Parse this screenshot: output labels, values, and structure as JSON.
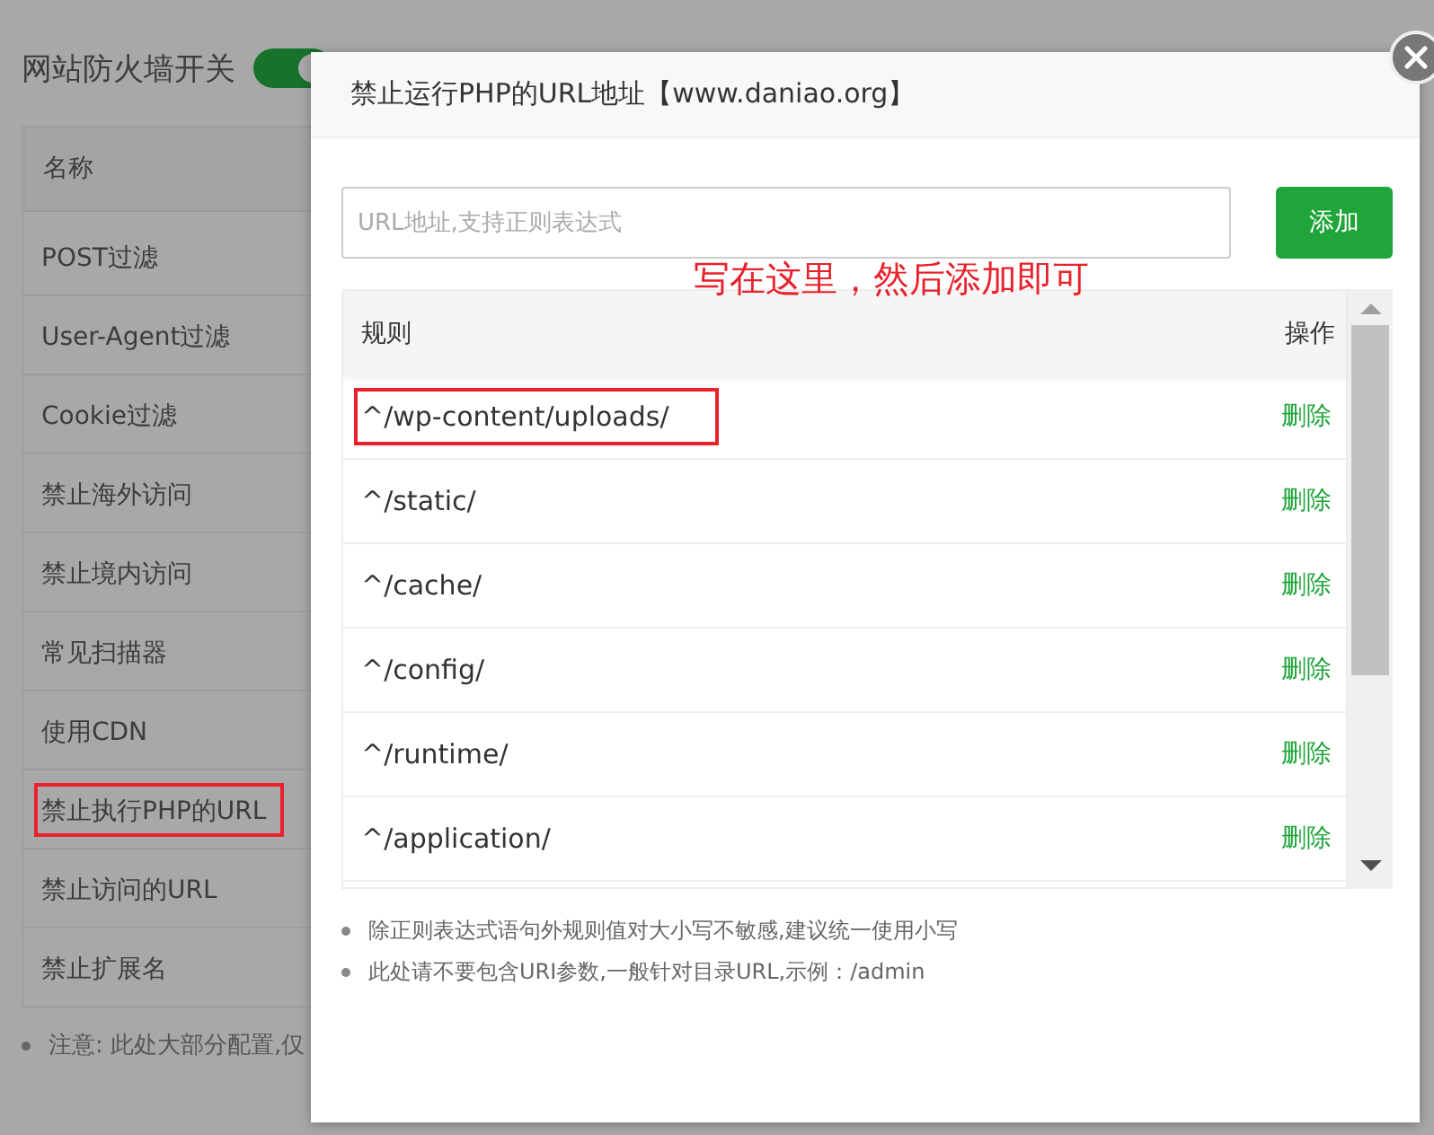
{
  "page": {
    "title": "网站防火墙开关",
    "switch_on": true,
    "column": "名称",
    "items": [
      {
        "label": "POST过滤",
        "annotated": false
      },
      {
        "label": "User-Agent过滤",
        "annotated": false
      },
      {
        "label": "Cookie过滤",
        "annotated": false
      },
      {
        "label": "禁止海外访问",
        "annotated": false
      },
      {
        "label": "禁止境内访问",
        "annotated": false
      },
      {
        "label": "常见扫描器",
        "annotated": false
      },
      {
        "label": "使用CDN",
        "annotated": false
      },
      {
        "label": "禁止执行PHP的URL",
        "annotated": true
      },
      {
        "label": "禁止访问的URL",
        "annotated": false
      },
      {
        "label": "禁止扩展名",
        "annotated": false
      }
    ],
    "note": "注意: 此处大部分配置,仅"
  },
  "dialog": {
    "title": "禁止运行PHP的URL地址【www.daniao.org】",
    "placeholder": "URL地址,支持正则表达式",
    "add_button": "添加",
    "annotation": "写在这里，然后添加即可",
    "columns": [
      "规则",
      "操作"
    ],
    "rows": [
      {
        "rule": "^/wp-content/uploads/",
        "action": "删除",
        "annotated": true
      },
      {
        "rule": "^/static/",
        "action": "删除",
        "annotated": false
      },
      {
        "rule": "^/cache/",
        "action": "删除",
        "annotated": false
      },
      {
        "rule": "^/config/",
        "action": "删除",
        "annotated": false
      },
      {
        "rule": "^/runtime/",
        "action": "删除",
        "annotated": false
      },
      {
        "rule": "^/application/",
        "action": "删除",
        "annotated": false
      }
    ],
    "notes": [
      "除正则表达式语句外规则值对大小写不敏感,建议统一使用小写",
      "此处请不要包含URI参数,一般针对目录URL,示例：/admin"
    ]
  }
}
